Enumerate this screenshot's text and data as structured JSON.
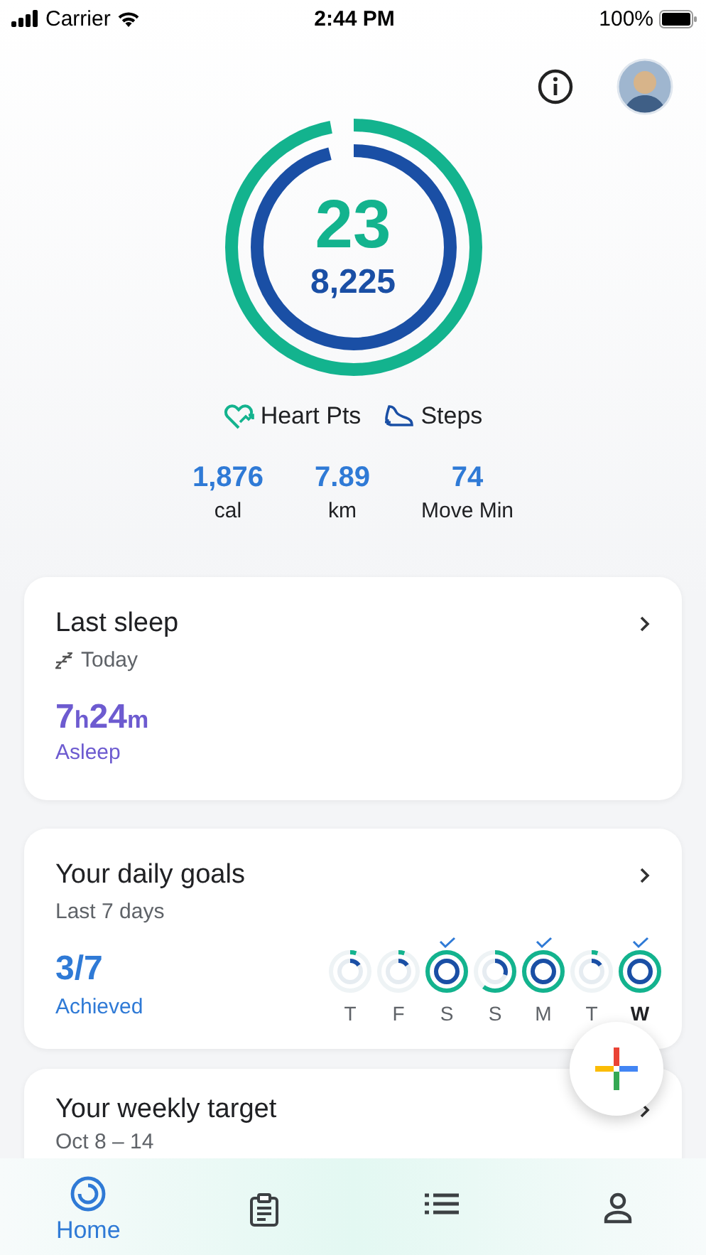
{
  "status_bar": {
    "carrier": "Carrier",
    "time": "2:44 PM",
    "battery": "100%"
  },
  "summary": {
    "heart_points": {
      "value": "23",
      "level": 0.97
    },
    "steps": {
      "value": "8,225",
      "level": 0.96
    }
  },
  "legend": [
    {
      "kind": "heart",
      "label": "Heart Pts"
    },
    {
      "kind": "steps",
      "label": "Steps"
    }
  ],
  "stats": [
    {
      "value": "1,876",
      "label": "cal"
    },
    {
      "value": "7.89",
      "label": "km"
    },
    {
      "value": "74",
      "label": "Move Min"
    }
  ],
  "sleep_card": {
    "title": "Last sleep",
    "subtitle": "Today",
    "hours": "7",
    "hours_unit": "h",
    "minutes": "24",
    "minutes_unit": "m",
    "caption": "Asleep"
  },
  "goals_card": {
    "title": "Your daily goals",
    "subtitle": "Last 7 days",
    "achieved": "3/7",
    "caption": "Achieved",
    "days": [
      {
        "label": "T",
        "heart": {
          "level": 0.05
        },
        "steps": {
          "level": 0.15
        },
        "met": false,
        "today": false
      },
      {
        "label": "F",
        "heart": {
          "level": 0.05
        },
        "steps": {
          "level": 0.15
        },
        "met": false,
        "today": false
      },
      {
        "label": "S",
        "heart": {
          "level": 1
        },
        "steps": {
          "level": 1
        },
        "met": true,
        "today": false
      },
      {
        "label": "S",
        "heart": {
          "level": 0.6
        },
        "steps": {
          "level": 0.3
        },
        "met": false,
        "today": false
      },
      {
        "label": "M",
        "heart": {
          "level": 1
        },
        "steps": {
          "level": 1
        },
        "met": true,
        "today": false
      },
      {
        "label": "T",
        "heart": {
          "level": 0.05
        },
        "steps": {
          "level": 0.15
        },
        "met": false,
        "today": false
      },
      {
        "label": "W",
        "heart": {
          "level": 1
        },
        "steps": {
          "level": 1
        },
        "met": true,
        "today": true
      }
    ]
  },
  "target_card": {
    "title": "Your weekly target",
    "subtitle": "Oct 8 – 14"
  },
  "nav": [
    {
      "kind": "home",
      "label": "Home",
      "selected": true
    },
    {
      "kind": "journal",
      "selected": false
    },
    {
      "kind": "browse",
      "selected": false
    },
    {
      "kind": "profile",
      "selected": false
    }
  ]
}
